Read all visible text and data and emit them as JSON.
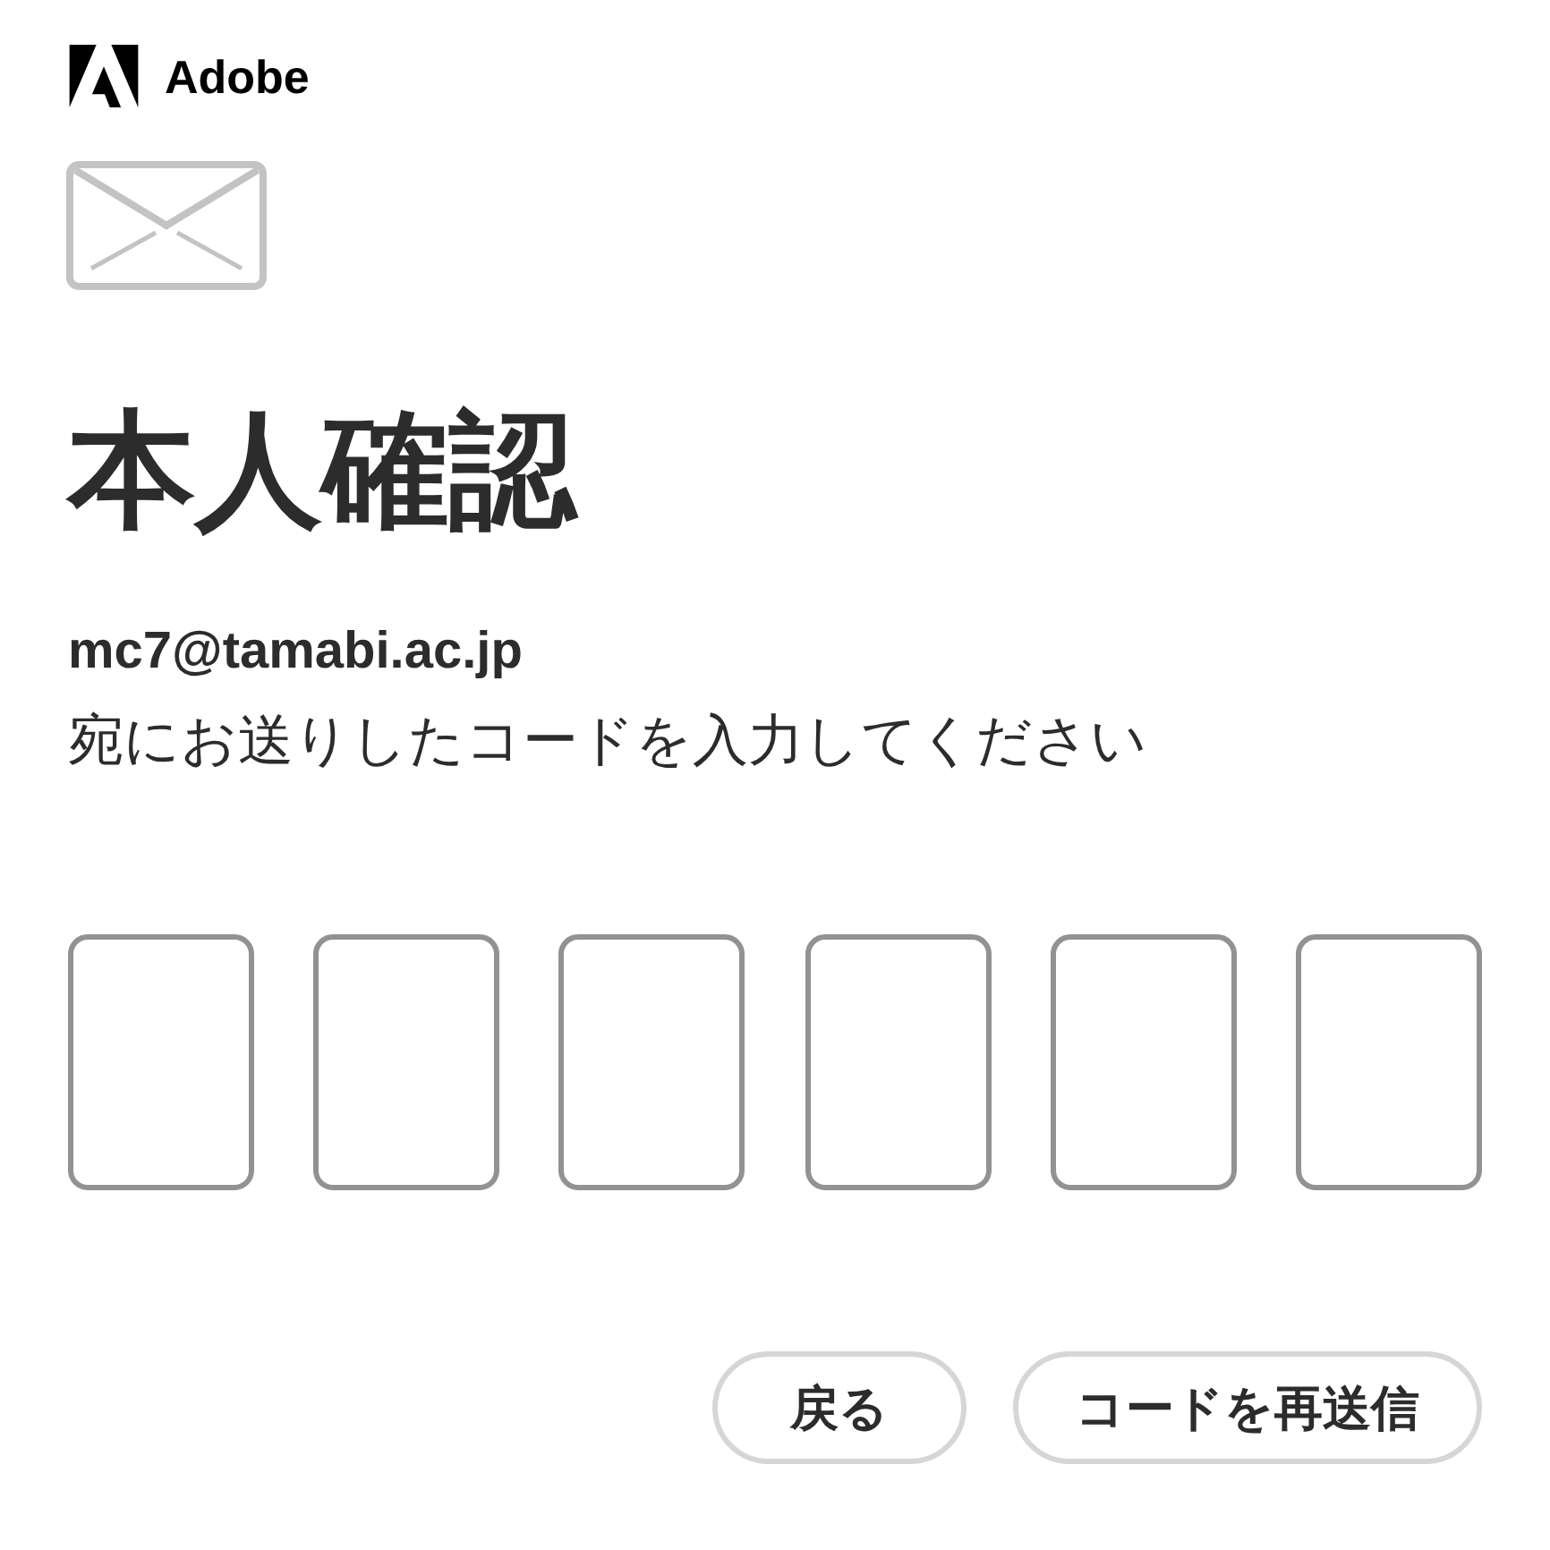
{
  "brand": {
    "name": "Adobe"
  },
  "heading": "本人確認",
  "email": "mc7@tamabi.ac.jp",
  "instruction": "宛にお送りしたコードを入力してください",
  "code_fields": [
    {
      "kind": "digit"
    },
    {
      "kind": "digit"
    },
    {
      "kind": "digit"
    },
    {
      "kind": "digit"
    },
    {
      "kind": "digit"
    },
    {
      "kind": "digit"
    }
  ],
  "buttons": [
    {
      "label": "戻る"
    },
    {
      "label": "コードを再送信"
    }
  ]
}
